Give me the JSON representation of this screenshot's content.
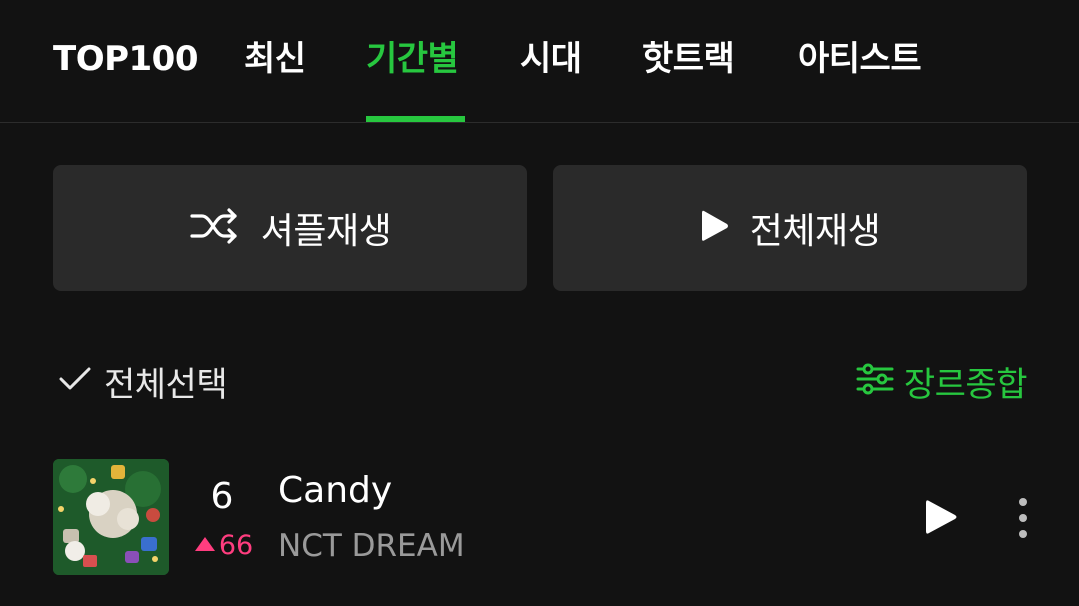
{
  "tabs": [
    {
      "label": "TOP100",
      "active": false
    },
    {
      "label": "최신",
      "active": false
    },
    {
      "label": "기간별",
      "active": true
    },
    {
      "label": "시대",
      "active": false
    },
    {
      "label": "핫트랙",
      "active": false
    },
    {
      "label": "아티스트",
      "active": false
    }
  ],
  "actions": {
    "shuffle_label": "셔플재생",
    "play_all_label": "전체재생"
  },
  "list_controls": {
    "select_all_label": "전체선택",
    "genre_label": "장르종합"
  },
  "songs": [
    {
      "rank": "6",
      "change": "66",
      "change_direction": "up",
      "title": "Candy",
      "artist": "NCT DREAM"
    }
  ],
  "colors": {
    "accent": "#27c73f",
    "background": "#121212",
    "button_bg": "#2a2a2a",
    "rank_up": "#ff3d7f"
  },
  "icons": {
    "shuffle": "shuffle-icon",
    "play": "play-icon",
    "check": "check-icon",
    "filter": "filter-sliders-icon",
    "more": "more-vertical-icon"
  }
}
